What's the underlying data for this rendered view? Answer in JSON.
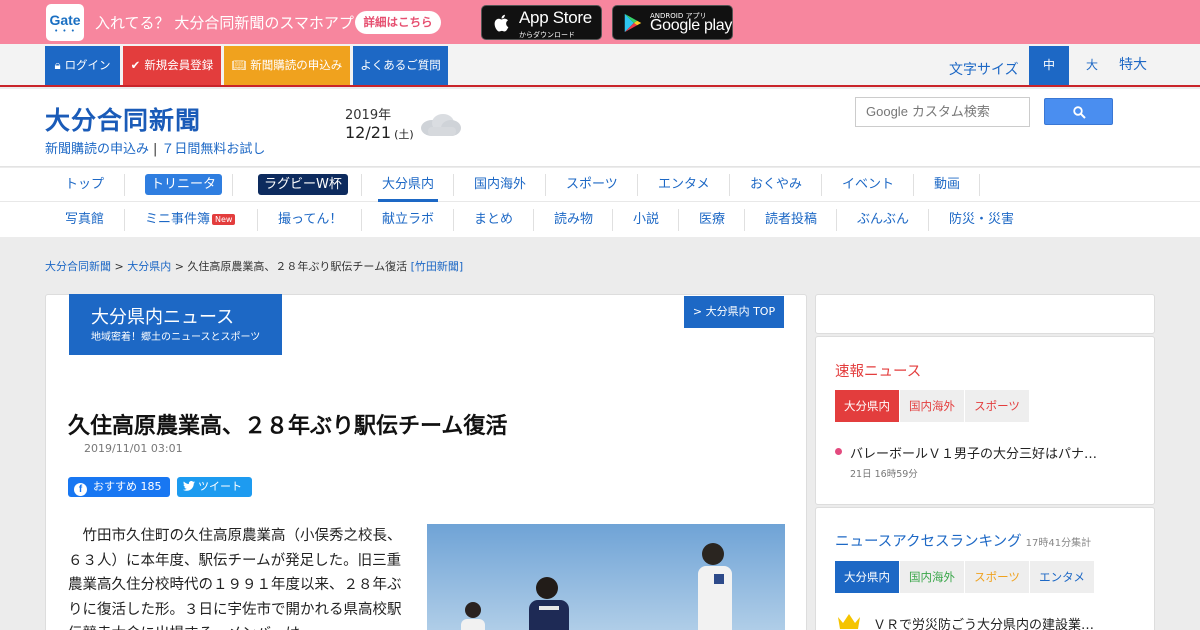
{
  "promo": {
    "gate_label": "Gate",
    "message": "入れてる？ 大分合同新聞のスマホアプリ",
    "detail_button": "詳細はこちら",
    "appstore_big": "App Store",
    "appstore_small": "からダウンロード",
    "googleplay_small": "ANDROID アプリ",
    "googleplay_big": "Google play",
    "bg_color": "#f7869e"
  },
  "topbar": {
    "login": "ログイン",
    "register": "新規会員登録",
    "subscribe": "新聞購読の申込み",
    "faq": "よくあるご質問",
    "font_size_label": "文字サイズ",
    "font_mid": "中",
    "font_large": "大",
    "font_xlarge": "特大"
  },
  "header": {
    "logo": "大分合同新聞",
    "link_subscribe": "新聞購読の申込み",
    "separator": "|",
    "link_trial": "７日間無料お試し",
    "year": "2019年",
    "date": "12/21",
    "dow": "(土)",
    "weather_icon": "cloudy-icon",
    "search_brand": "Google",
    "search_placeholder": "カスタム検索"
  },
  "nav": {
    "row1": [
      "トップ",
      "トリニータ",
      "ラグビーW杯",
      "大分県内",
      "国内海外",
      "スポーツ",
      "エンタメ",
      "おくやみ",
      "イベント",
      "動画"
    ],
    "row2": [
      "写真館",
      "ミニ事件簿",
      "撮ってん！",
      "献立ラボ",
      "まとめ",
      "読み物",
      "小説",
      "医療",
      "読者投稿",
      "ぶんぶん",
      "防災・災害"
    ],
    "new_badge": "New",
    "active": "大分県内"
  },
  "breadcrumb": {
    "home": "大分合同新聞",
    "sep": ">",
    "section": "大分県内",
    "current": "久住高原農業高、２８年ぶり駅伝チーム復活",
    "source": "[竹田新聞]"
  },
  "article": {
    "section_title": "大分県内ニュース",
    "section_sub": "地域密着！郷土のニュースとスポーツ",
    "section_top_link": "> 大分県内 TOP",
    "headline": "久住高原農業高、２８年ぶり駅伝チーム復活",
    "date": "2019/11/01 03:01",
    "fb_label": "おすすめ",
    "fb_count": "185",
    "tweet_label": "ツイート",
    "body": "竹田市久住町の久住高原農業高（小俣秀之校長、６３人）に本年度、駅伝チームが発足した。旧三重農業高久住分校時代の１９９１年度以来、２８年ぶりに復活した形。３日に宇佐市で開かれる県高校駅伝競走大会に出場する。メンバーは"
  },
  "sidebar": {
    "breaking_title": "速報ニュース",
    "breaking_tabs": [
      "大分県内",
      "国内海外",
      "スポーツ"
    ],
    "breaking_item": "バレーボールＶ１男子の大分三好はパナ…",
    "breaking_time": "21日 16時59分",
    "ranking_title": "ニュースアクセスランキング",
    "ranking_agg": "17時41分集計",
    "ranking_tabs": [
      "大分県内",
      "国内海外",
      "スポーツ",
      "エンタメ"
    ],
    "ranking_item": "ＶＲで労災防ごう大分県内の建設業…"
  },
  "colors": {
    "brand_blue": "#1d68c5",
    "accent_red": "#e33d3d",
    "accent_orange": "#f0a21e",
    "rugby_navy": "#0d2b5e"
  }
}
